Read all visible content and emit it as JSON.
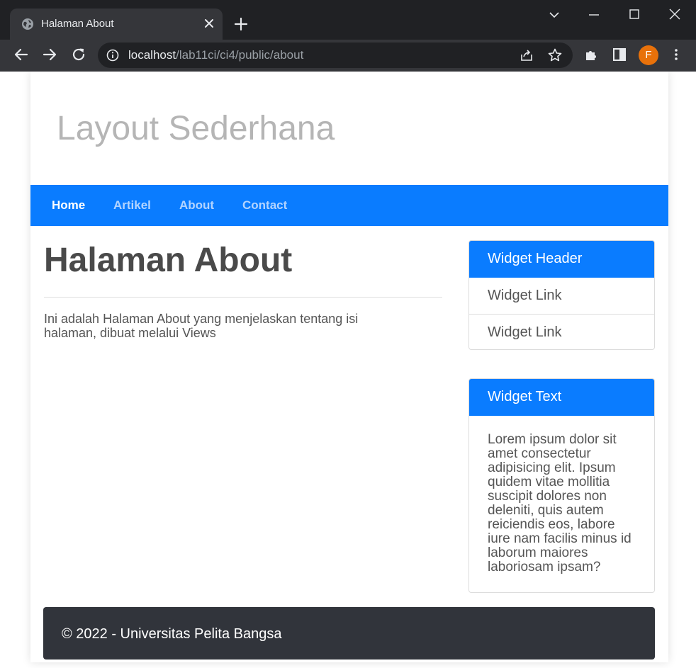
{
  "browser": {
    "tab_title": "Halaman About",
    "url_host": "localhost",
    "url_path": "/lab11ci/ci4/public/about",
    "profile_initial": "F"
  },
  "site": {
    "title": "Layout Sederhana",
    "nav": [
      {
        "label": "Home",
        "active": true
      },
      {
        "label": "Artikel",
        "active": false
      },
      {
        "label": "About",
        "active": false
      },
      {
        "label": "Contact",
        "active": false
      }
    ]
  },
  "main": {
    "heading": "Halaman About",
    "text": "Ini adalah Halaman About yang menjelaskan tentang isi halaman, dibuat melalui Views"
  },
  "sidebar": {
    "widget1": {
      "header": "Widget Header",
      "links": [
        "Widget Link",
        "Widget Link"
      ]
    },
    "widget2": {
      "header": "Widget Text",
      "body": "Lorem ipsum dolor sit amet consectetur adipisicing elit. Ipsum quidem vitae mollitia suscipit dolores non deleniti, quis autem reiciendis eos, labore iure nam facilis minus id laborum maiores laboriosam ipsam?"
    }
  },
  "footer": {
    "text": "© 2022 - Universitas Pelita Bangsa"
  },
  "colors": {
    "accent": "#0a7cff",
    "footer_bg": "#31343b",
    "title_gray": "#b5b5b5",
    "chrome_dark": "#202124",
    "profile": "#e8710a"
  }
}
